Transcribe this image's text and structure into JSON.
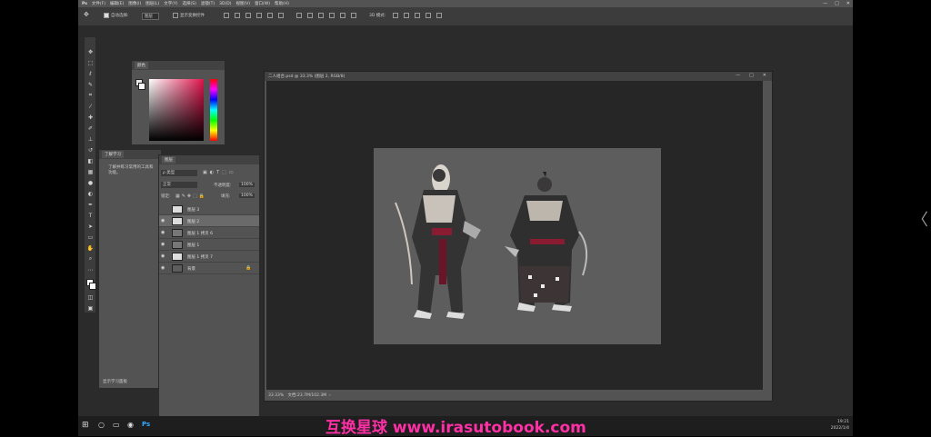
{
  "menubar": {
    "logo": "Ps",
    "items": [
      "文件(F)",
      "编辑(E)",
      "图像(I)",
      "图层(L)",
      "文字(Y)",
      "选择(S)",
      "滤镜(T)",
      "3D(D)",
      "视图(V)",
      "窗口(W)",
      "帮助(H)"
    ],
    "window_controls": [
      "—",
      "□",
      "✕"
    ]
  },
  "options": {
    "auto_select": "自动选择:",
    "auto_select_value": "图层",
    "transform": "显示变换控件",
    "mode3d": "3D 模式:"
  },
  "color_panel": {
    "tab": "颜色"
  },
  "learn_panel": {
    "tab": "了解学习",
    "body": "了解并练习常用的工具和功能。",
    "footer": "显示学习面板"
  },
  "layers_panel": {
    "tab": "图层",
    "filter": "ρ 类型",
    "blend": "正常",
    "opacity_label": "不透明度:",
    "opacity": "100%",
    "lock_label": "锁定:",
    "fill_label": "填充:",
    "fill": "100%",
    "layers": [
      {
        "name": "图层 3",
        "visible": false,
        "selected": false
      },
      {
        "name": "图层 2",
        "visible": true,
        "selected": true
      },
      {
        "name": "图层 1 拷贝 6",
        "visible": true,
        "selected": false
      },
      {
        "name": "图层 1",
        "visible": true,
        "selected": false
      },
      {
        "name": "图层 1 拷贝 7",
        "visible": true,
        "selected": false
      },
      {
        "name": "背景",
        "visible": true,
        "selected": false
      }
    ]
  },
  "document": {
    "title": "二人组合.psd @ 33.3% (图层 2, RGB/8)",
    "zoom": "33.33%",
    "status": "文档:23.7M/102.3M",
    "controls": [
      "—",
      "□",
      "✕"
    ]
  },
  "taskbar": {
    "time": "19:21",
    "date": "2022/1/4"
  },
  "watermark": "互换星球 www.irasutobook.com",
  "side_arrow": "〈"
}
